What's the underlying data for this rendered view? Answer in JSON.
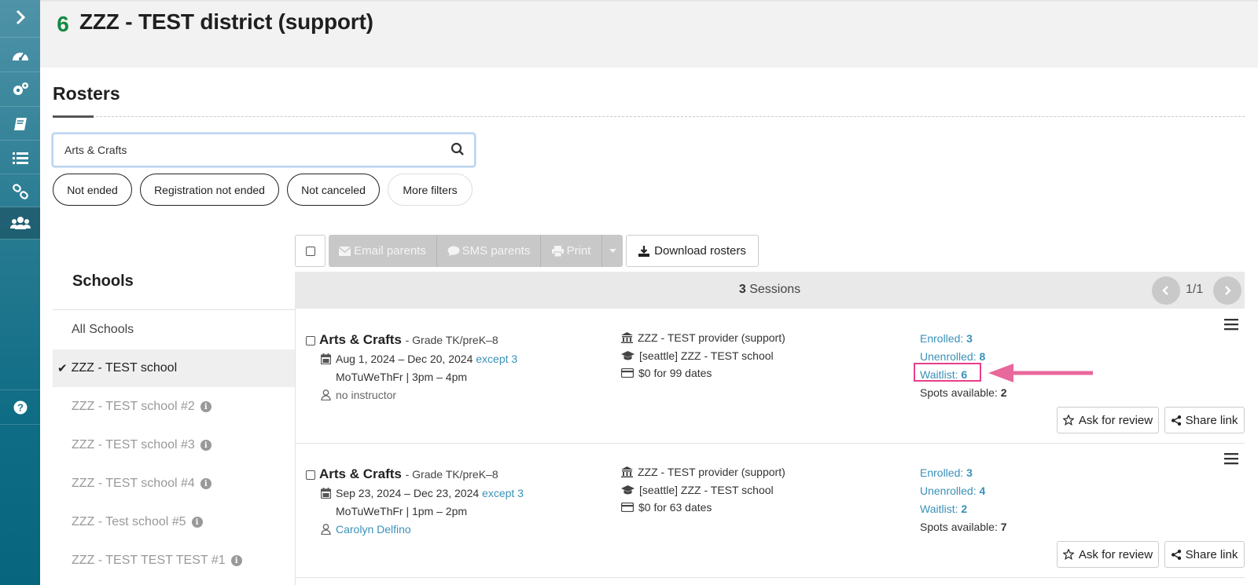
{
  "sidebar": {
    "icons": [
      "chevron-right-icon",
      "dashboard-icon",
      "gears-icon",
      "book-icon",
      "list-icon",
      "link-icon",
      "users-icon",
      "help-icon"
    ]
  },
  "header": {
    "district_name": "ZZZ - TEST district (support)"
  },
  "page": {
    "title": "Rosters"
  },
  "search": {
    "value": "Arts & Crafts"
  },
  "filters": [
    "Not ended",
    "Registration not ended",
    "Not canceled",
    "More filters"
  ],
  "schools": {
    "title": "Schools",
    "items": [
      {
        "label": "All Schools"
      },
      {
        "label": "ZZZ - TEST school"
      },
      {
        "label": "ZZZ - TEST school #2"
      },
      {
        "label": "ZZZ - TEST school #3"
      },
      {
        "label": "ZZZ - TEST school #4"
      },
      {
        "label": "ZZZ - Test school #5"
      },
      {
        "label": "ZZZ - TEST TEST TEST #1"
      }
    ]
  },
  "toolbar": {
    "email_label": "Email parents",
    "sms_label": "SMS parents",
    "print_label": "Print",
    "download_label": "Download rosters"
  },
  "sessions_bar": {
    "count": "3",
    "count_label": "Sessions",
    "page_indicator": "1/1"
  },
  "sessions": [
    {
      "title": "Arts & Crafts",
      "grade": "- Grade TK/preK–8",
      "dates": "Aug 1, 2024 – Dec 20, 2024",
      "except": "except 3",
      "schedule": "MoTuWeThFr | 3pm – 4pm",
      "instructor": "no instructor",
      "provider": "ZZZ - TEST provider (support)",
      "school": "[seattle] ZZZ - TEST school",
      "price": "$0 for 99 dates",
      "enrolled_label": "Enrolled:",
      "enrolled": "3",
      "unenrolled_label": "Unenrolled:",
      "unenrolled": "8",
      "waitlist_label": "Waitlist:",
      "waitlist": "6",
      "spots_label": "Spots available:",
      "spots": "2",
      "review_label": "Ask for review",
      "share_label": "Share link"
    },
    {
      "title": "Arts & Crafts",
      "grade": "- Grade TK/preK–8",
      "dates": "Sep 23, 2024 – Dec 23, 2024",
      "except": "except 3",
      "schedule": "MoTuWeThFr | 1pm – 2pm",
      "instructor": "Carolyn Delfino",
      "provider": "ZZZ - TEST provider (support)",
      "school": "[seattle] ZZZ - TEST school",
      "price": "$0 for 63 dates",
      "enrolled_label": "Enrolled:",
      "enrolled": "3",
      "unenrolled_label": "Unenrolled:",
      "unenrolled": "4",
      "waitlist_label": "Waitlist:",
      "waitlist": "2",
      "spots_label": "Spots available:",
      "spots": "7",
      "review_label": "Ask for review",
      "share_label": "Share link"
    }
  ],
  "colors": {
    "accent_link": "#3a91b9",
    "highlight": "#e83e8c",
    "sidebar": "#0f6d85"
  }
}
